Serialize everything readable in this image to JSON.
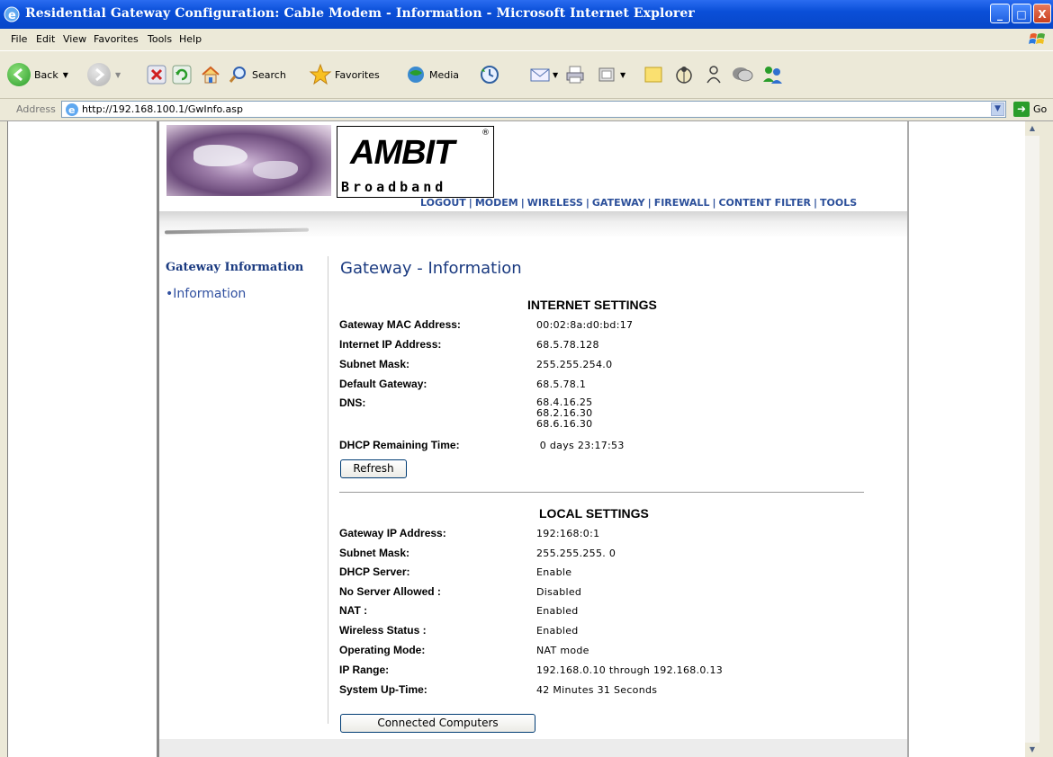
{
  "window": {
    "title": "Residential Gateway Configuration: Cable Modem - Information - Microsoft Internet Explorer",
    "min_label": "_",
    "max_label": "□",
    "close_label": "X"
  },
  "menu": [
    "File",
    "Edit",
    "View",
    "Favorites",
    "Tools",
    "Help"
  ],
  "toolbar": {
    "back_label": "Back",
    "search_label": "Search",
    "favorites_label": "Favorites",
    "media_label": "Media"
  },
  "address": {
    "label": "Address",
    "url": "http://192.168.100.1/GwInfo.asp",
    "go_label": "Go"
  },
  "brand": {
    "logo": "AMBIT",
    "tagline": "Broadband",
    "reg": "®"
  },
  "topnav": [
    "LOGOUT",
    "MODEM",
    "WIRELESS",
    "GATEWAY",
    "FIREWALL",
    "CONTENT FILTER",
    "TOOLS"
  ],
  "leftnav": {
    "heading": "Gateway Information",
    "item": "•Information"
  },
  "page": {
    "title": "Gateway - Information"
  },
  "internet": {
    "heading": "INTERNET SETTINGS",
    "rows": [
      {
        "label": "Gateway MAC Address:",
        "value": "00:02:8a:d0:bd:17"
      },
      {
        "label": "Internet IP Address:",
        "value": "68.5.78.128"
      },
      {
        "label": "Subnet Mask:",
        "value": "255.255.254.0"
      },
      {
        "label": "Default Gateway:",
        "value": "68.5.78.1"
      },
      {
        "label": "DNS:",
        "value": "68.4.16.25\n68.2.16.30\n68.6.16.30"
      },
      {
        "label": "DHCP Remaining Time:",
        "value": " 0 days 23:17:53"
      }
    ],
    "refresh_label": "Refresh"
  },
  "local": {
    "heading": "LOCAL SETTINGS",
    "rows": [
      {
        "label": "Gateway IP Address:",
        "value": "192:168:0:1"
      },
      {
        "label": "Subnet Mask:",
        "value": "255.255.255. 0"
      },
      {
        "label": "DHCP Server:",
        "value": "Enable"
      },
      {
        "label": "No Server Allowed :",
        "value": "Disabled"
      },
      {
        "label": "NAT :",
        "value": "Enabled"
      },
      {
        "label": "Wireless Status :",
        "value": "Enabled"
      },
      {
        "label": "Operating Mode:",
        "value": "NAT mode"
      },
      {
        "label": "IP Range:",
        "value": "192.168.0.10 through 192.168.0.13"
      },
      {
        "label": "System Up-Time:",
        "value": "42 Minutes 31 Seconds"
      }
    ],
    "connected_label": "Connected Computers"
  }
}
